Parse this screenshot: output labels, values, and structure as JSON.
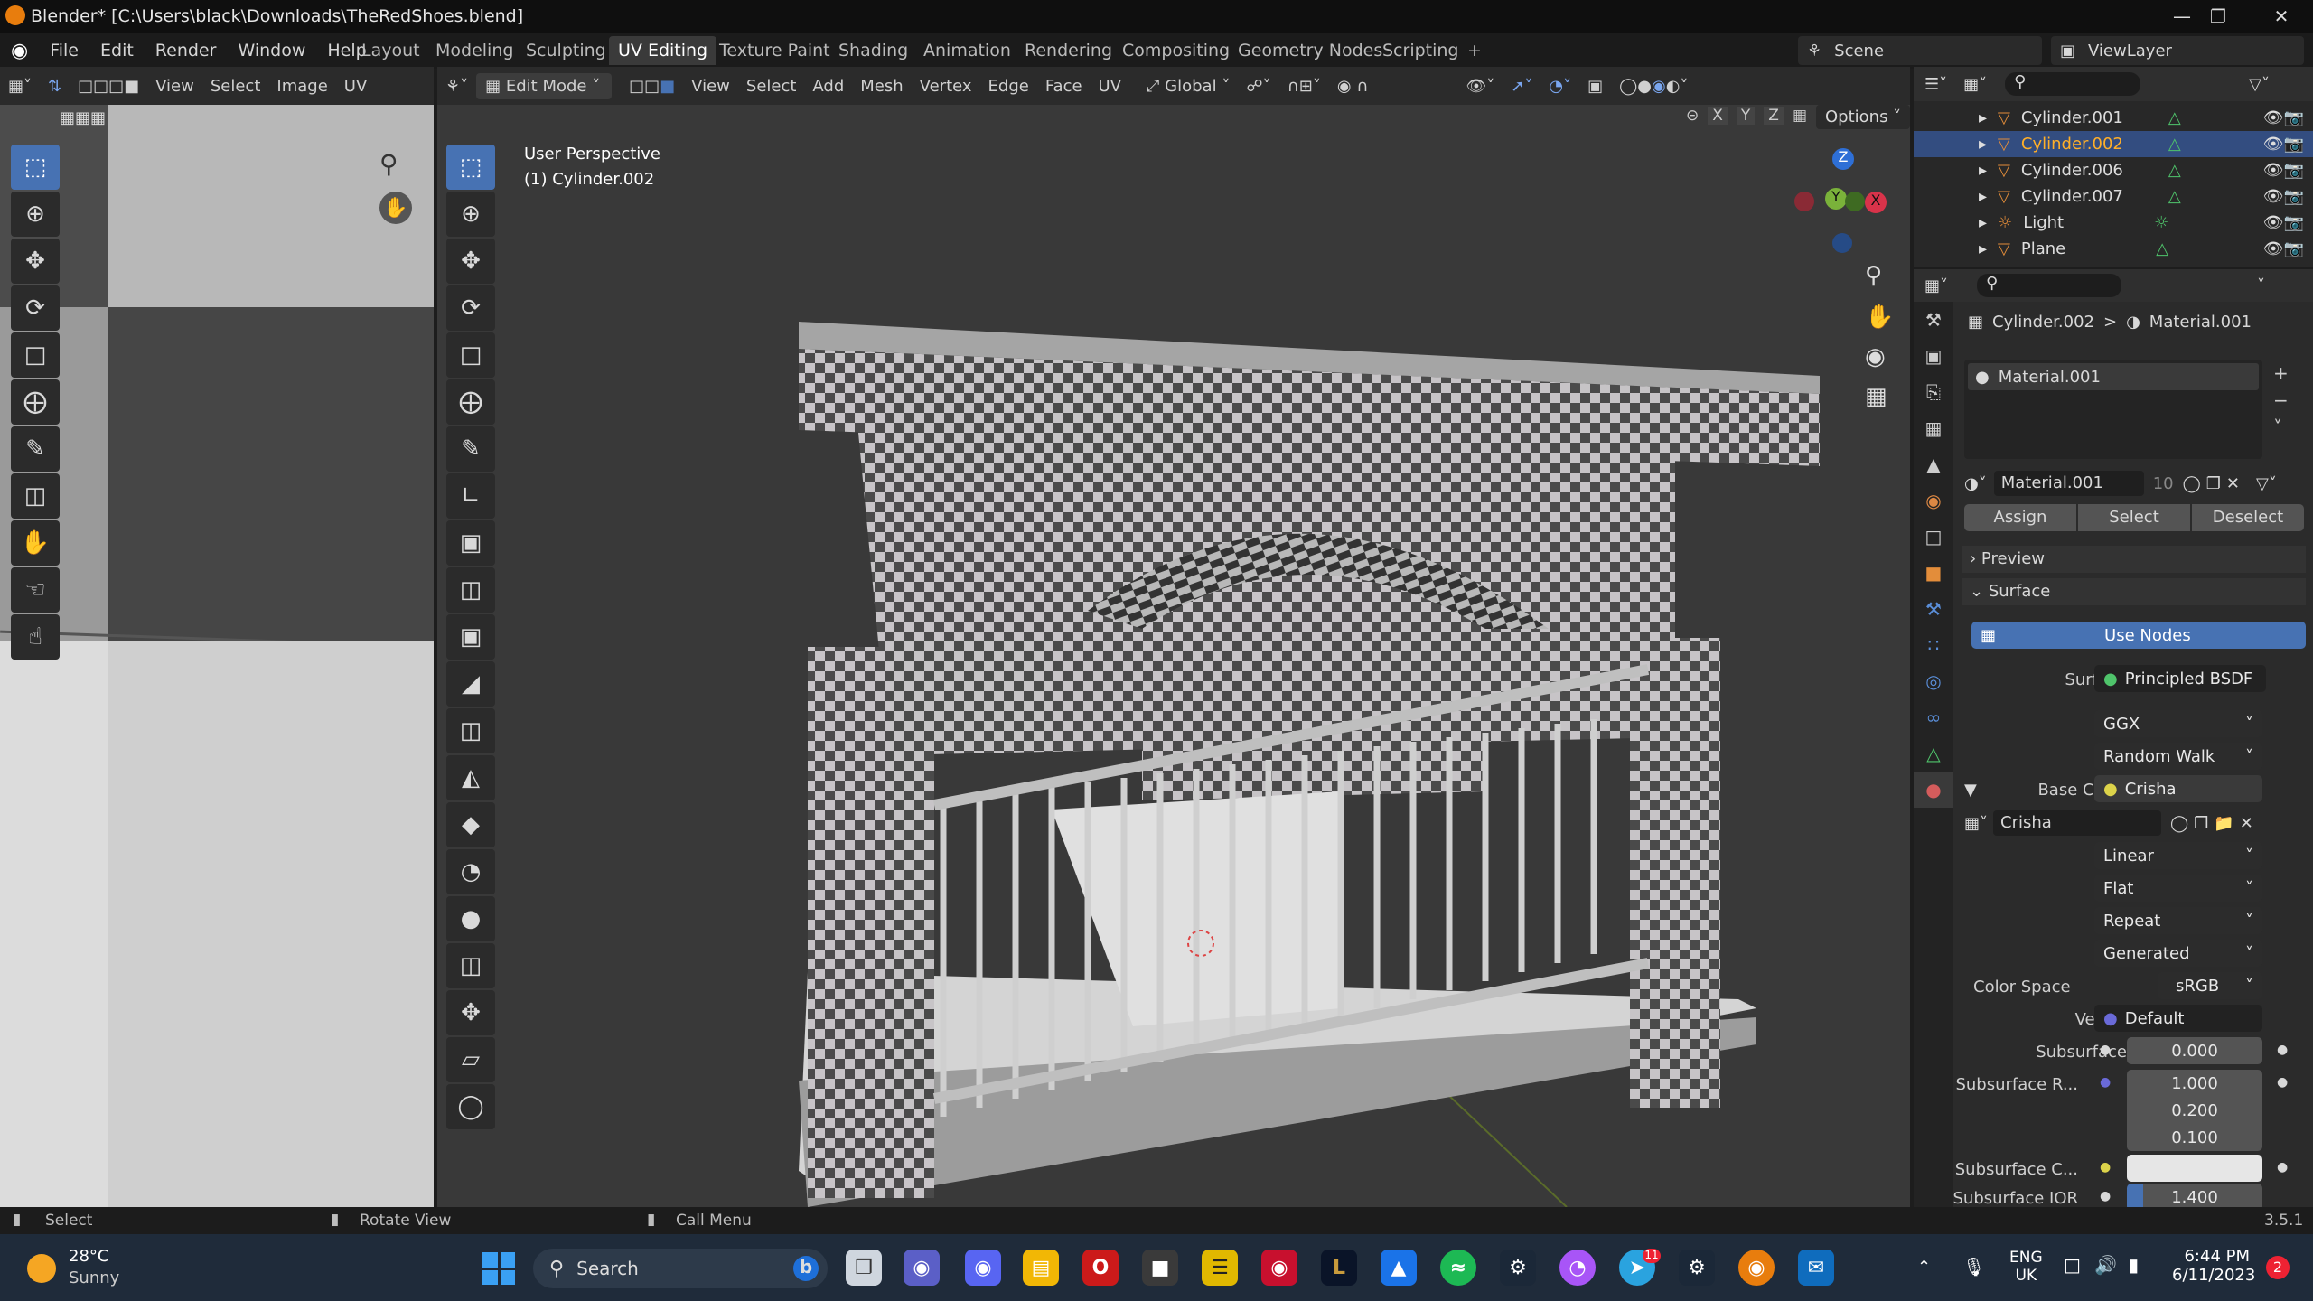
{
  "window": {
    "title": "Blender* [C:\\Users\\black\\Downloads\\TheRedShoes.blend]"
  },
  "menu": [
    "File",
    "Edit",
    "Render",
    "Window",
    "Help"
  ],
  "workspaces": [
    "Layout",
    "Modeling",
    "Sculpting",
    "UV Editing",
    "Texture Paint",
    "Shading",
    "Animation",
    "Rendering",
    "Compositing",
    "Geometry Nodes",
    "Scripting",
    "+"
  ],
  "scene": "Scene",
  "view_layer": "ViewLayer",
  "uv_header": {
    "view": "View",
    "select": "Select",
    "image": "Image",
    "uv": "UV"
  },
  "view3d_header": {
    "mode": "Edit Mode",
    "view": "View",
    "select": "Select",
    "add": "Add",
    "mesh": "Mesh",
    "vertex": "Vertex",
    "edge": "Edge",
    "face": "Face",
    "uv": "UV",
    "orientation": "Global",
    "options": "Options",
    "x": "X",
    "y": "Y",
    "z": "Z"
  },
  "viewport": {
    "perspective": "User Perspective",
    "object": "(1) Cylinder.002"
  },
  "gizmo": {
    "z": "Z",
    "y": "Y",
    "x": "X"
  },
  "outliner": [
    {
      "name": "Cylinder.001",
      "selected": false
    },
    {
      "name": "Cylinder.002",
      "selected": true
    },
    {
      "name": "Cylinder.006",
      "selected": false
    },
    {
      "name": "Cylinder.007",
      "selected": false
    },
    {
      "name": "Light",
      "selected": false
    },
    {
      "name": "Plane",
      "selected": false
    }
  ],
  "properties": {
    "breadcrumb_obj": "Cylinder.002",
    "breadcrumb_mat": "Material.001",
    "slot": "Material.001",
    "mat_name": "Material.001",
    "users": "10",
    "assign": "Assign",
    "select": "Select",
    "deselect": "Deselect",
    "preview": "Preview",
    "surface_panel": "Surface",
    "use_nodes": "Use Nodes",
    "surface_label": "Surface",
    "surface_val": "Principled BSDF",
    "ggx": "GGX",
    "random_walk": "Random Walk",
    "base_color_label": "Base Color",
    "base_color_val": "Crisha",
    "image_name": "Crisha",
    "linear": "Linear",
    "flat": "Flat",
    "repeat": "Repeat",
    "generated": "Generated",
    "color_space_label": "Color Space",
    "color_space_val": "sRGB",
    "vector_label": "Vector",
    "vector_val": "Default",
    "subsurface_label": "Subsurface",
    "subsurface_val": "0.000",
    "subsurface_r_label": "Subsurface R...",
    "sr1": "1.000",
    "sr2": "0.200",
    "sr3": "0.100",
    "subsurface_c_label": "Subsurface C...",
    "subsurface_ior_label": "Subsurface IOR",
    "subsurface_ior_val": "1.400"
  },
  "status": {
    "select": "Select",
    "rotate": "Rotate View",
    "call_menu": "Call Menu",
    "version": "3.5.1"
  },
  "taskbar": {
    "temp": "28°C",
    "weather": "Sunny",
    "search": "Search",
    "lang1": "ENG",
    "lang2": "UK",
    "time": "6:44 PM",
    "date": "6/11/2023",
    "notif": "2"
  },
  "colors": {
    "accent": "#4772b3",
    "selected_row": "#334d80",
    "taskbar": "#1f2b3a"
  }
}
